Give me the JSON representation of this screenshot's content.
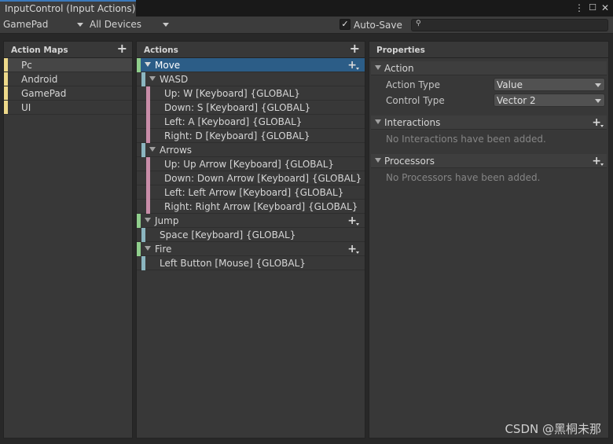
{
  "window": {
    "title": "InputControl (Input Actions)",
    "controls": {
      "menu": "⋮",
      "maximize": "☐",
      "close": "✕"
    }
  },
  "toolbar": {
    "control_scheme": "GamePad",
    "devices": "All Devices",
    "autosave_checked": "✓",
    "autosave_label": "Auto-Save",
    "search_value": "",
    "search_icon": "⚲"
  },
  "action_maps": {
    "header": "Action Maps",
    "add": "+",
    "items": [
      {
        "label": "Pc",
        "selected": true
      },
      {
        "label": "Android"
      },
      {
        "label": "GamePad"
      },
      {
        "label": "UI"
      }
    ]
  },
  "actions": {
    "header": "Actions",
    "add": "+",
    "rows": [
      {
        "label": "Move",
        "kind": "action",
        "selected": true,
        "has_add": true
      },
      {
        "label": "WASD",
        "kind": "composite"
      },
      {
        "label": "Up: W [Keyboard] {GLOBAL}",
        "kind": "part"
      },
      {
        "label": "Down: S [Keyboard] {GLOBAL}",
        "kind": "part"
      },
      {
        "label": "Left: A [Keyboard] {GLOBAL}",
        "kind": "part"
      },
      {
        "label": "Right: D [Keyboard] {GLOBAL}",
        "kind": "part"
      },
      {
        "label": "Arrows",
        "kind": "composite"
      },
      {
        "label": "Up: Up Arrow [Keyboard] {GLOBAL}",
        "kind": "part"
      },
      {
        "label": "Down: Down Arrow [Keyboard] {GLOBAL}",
        "kind": "part"
      },
      {
        "label": "Left: Left Arrow [Keyboard] {GLOBAL}",
        "kind": "part"
      },
      {
        "label": "Right: Right Arrow [Keyboard] {GLOBAL}",
        "kind": "part"
      },
      {
        "label": "Jump",
        "kind": "action",
        "has_add": true
      },
      {
        "label": "Space [Keyboard] {GLOBAL}",
        "kind": "binding"
      },
      {
        "label": "Fire",
        "kind": "action",
        "has_add": true
      },
      {
        "label": "Left Button [Mouse] {GLOBAL}",
        "kind": "binding"
      }
    ]
  },
  "properties": {
    "header": "Properties",
    "action_section": "Action",
    "action_type_label": "Action Type",
    "action_type_value": "Value",
    "control_type_label": "Control Type",
    "control_type_value": "Vector 2",
    "interactions_section": "Interactions",
    "interactions_empty": "No Interactions have been added.",
    "processors_section": "Processors",
    "processors_empty": "No Processors have been added.",
    "add": "+"
  },
  "watermark": "CSDN @黑桐未那",
  "colors": {
    "map_stripe": "#eed98a",
    "action_stripe": "#8fce8c",
    "binding_stripe": "#8bb6c0",
    "part_stripe": "#c98da8",
    "selection": "#2c5d87",
    "tab_accent": "#3a79bb"
  }
}
